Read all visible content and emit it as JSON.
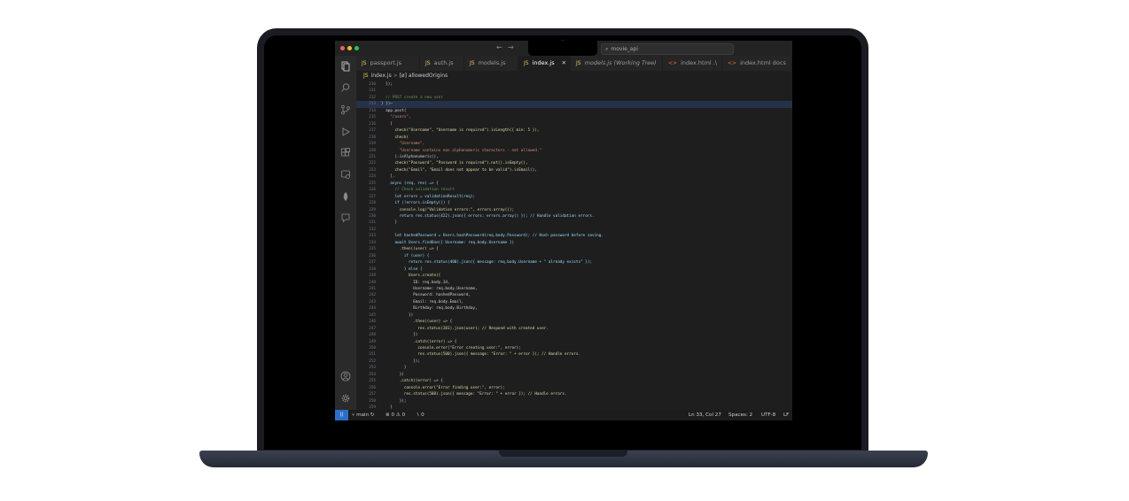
{
  "window": {
    "search_text": "movie_api",
    "search_icon": "search-icon"
  },
  "tabs": [
    {
      "label": "passport.js",
      "icon": "js-file-icon",
      "kind": "js"
    },
    {
      "label": "auth.js",
      "icon": "js-file-icon",
      "kind": "js"
    },
    {
      "label": "models.js",
      "icon": "js-file-icon",
      "kind": "js"
    },
    {
      "label": "index.js",
      "icon": "js-file-icon",
      "kind": "js",
      "active": true
    },
    {
      "label": "models.js (Working Tree)",
      "icon": "js-file-icon",
      "kind": "js"
    },
    {
      "label": "index.html .\\",
      "icon": "html-file-icon",
      "kind": "html"
    },
    {
      "label": "index.html docs",
      "icon": "html-file-icon",
      "kind": "html"
    }
  ],
  "breadcrumb": {
    "file": "index.js",
    "symbol": "[ø] allowedOrigins"
  },
  "code_lines": [
    {
      "n": "210",
      "t": "  });"
    },
    {
      "n": "211",
      "t": ""
    },
    {
      "n": "212",
      "t": "  // POST create a new user"
    },
    {
      "n": "213",
      "t": "} })—"
    },
    {
      "n": "214",
      "t": "  app.post("
    },
    {
      "n": "215",
      "t": "    \"/users\","
    },
    {
      "n": "216",
      "t": "    ["
    },
    {
      "n": "217",
      "t": "      check(\"Username\", \"Username is required\").isLength({ min: 5 }),"
    },
    {
      "n": "218",
      "t": "      check("
    },
    {
      "n": "219",
      "t": "        \"Username\","
    },
    {
      "n": "220",
      "t": "        \"Username contains non alphanumeric characters - not allowed.\""
    },
    {
      "n": "221",
      "t": "      ).isAlphanumeric(),"
    },
    {
      "n": "222",
      "t": "      check(\"Password\", \"Password is required\").not().isEmpty(),"
    },
    {
      "n": "223",
      "t": "      check(\"Email\", \"Email does not appear to be valid\").isEmail(),"
    },
    {
      "n": "224",
      "t": "    ],"
    },
    {
      "n": "225",
      "t": "    async (req, res) => {"
    },
    {
      "n": "226",
      "t": "      // Check validation result"
    },
    {
      "n": "227",
      "t": "      let errors = validationResult(req);"
    },
    {
      "n": "228",
      "t": "      if (!errors.isEmpty()) {"
    },
    {
      "n": "229",
      "t": "        console.log(\"Validation errors:\", errors.array());"
    },
    {
      "n": "230",
      "t": "        return res.status(422).json({ errors: errors.array() }); // Handle validation errors."
    },
    {
      "n": "231",
      "t": "      }"
    },
    {
      "n": "232",
      "t": ""
    },
    {
      "n": "233",
      "t": "      let hashedPassword = Users.hashPassword(req.body.Password); // Hash password before saving."
    },
    {
      "n": "234",
      "t": "      await Users.findOne({ Username: req.body.Username })"
    },
    {
      "n": "235",
      "t": "        .then((user) => {"
    },
    {
      "n": "236",
      "t": "          if (user) {"
    },
    {
      "n": "237",
      "t": "            return res.status(400).json({ message: req.body.Username + \" already exists\" });"
    },
    {
      "n": "238",
      "t": "          } else {"
    },
    {
      "n": "239",
      "t": "            Users.create({"
    },
    {
      "n": "240",
      "t": "              ID: req.body.Id,"
    },
    {
      "n": "241",
      "t": "              Username: req.body.Username,"
    },
    {
      "n": "242",
      "t": "              Password: hashedPassword,"
    },
    {
      "n": "243",
      "t": "              Email: req.body.Email,"
    },
    {
      "n": "244",
      "t": "              Birthday: req.body.Birthday,"
    },
    {
      "n": "245",
      "t": "            })"
    },
    {
      "n": "246",
      "t": "              .then((user) => {"
    },
    {
      "n": "247",
      "t": "                res.status(201).json(user); // Respond with created user."
    },
    {
      "n": "248",
      "t": "              })"
    },
    {
      "n": "249",
      "t": "              .catch((error) => {"
    },
    {
      "n": "250",
      "t": "                console.error(\"Error creating user:\", error);"
    },
    {
      "n": "251",
      "t": "                res.status(500).json({ message: \"Error: \" + error }); // Handle errors."
    },
    {
      "n": "252",
      "t": "              });"
    },
    {
      "n": "253",
      "t": "          }"
    },
    {
      "n": "254",
      "t": "        })"
    },
    {
      "n": "255",
      "t": "        .catch((error) => {"
    },
    {
      "n": "256",
      "t": "          console.error(\"Error finding user:\", error);"
    },
    {
      "n": "257",
      "t": "          res.status(500).json({ message: \"Error: \" + error }); // Handle errors."
    },
    {
      "n": "258",
      "t": "        });"
    },
    {
      "n": "259",
      "t": "    }"
    },
    {
      "n": "260",
      "t": "  );"
    }
  ],
  "statusbar": {
    "branch": "main",
    "errors": "0",
    "warnings": "0",
    "ports": "0",
    "cursor": "Ln 33, Col 27",
    "spaces": "Spaces: 2",
    "encoding": "UTF-8",
    "eol": "LF"
  },
  "colors": {
    "accent": "#2c6ec9",
    "editor_bg": "#1e1e1e",
    "js_icon": "#e8c85c",
    "html_icon": "#e2703a"
  }
}
